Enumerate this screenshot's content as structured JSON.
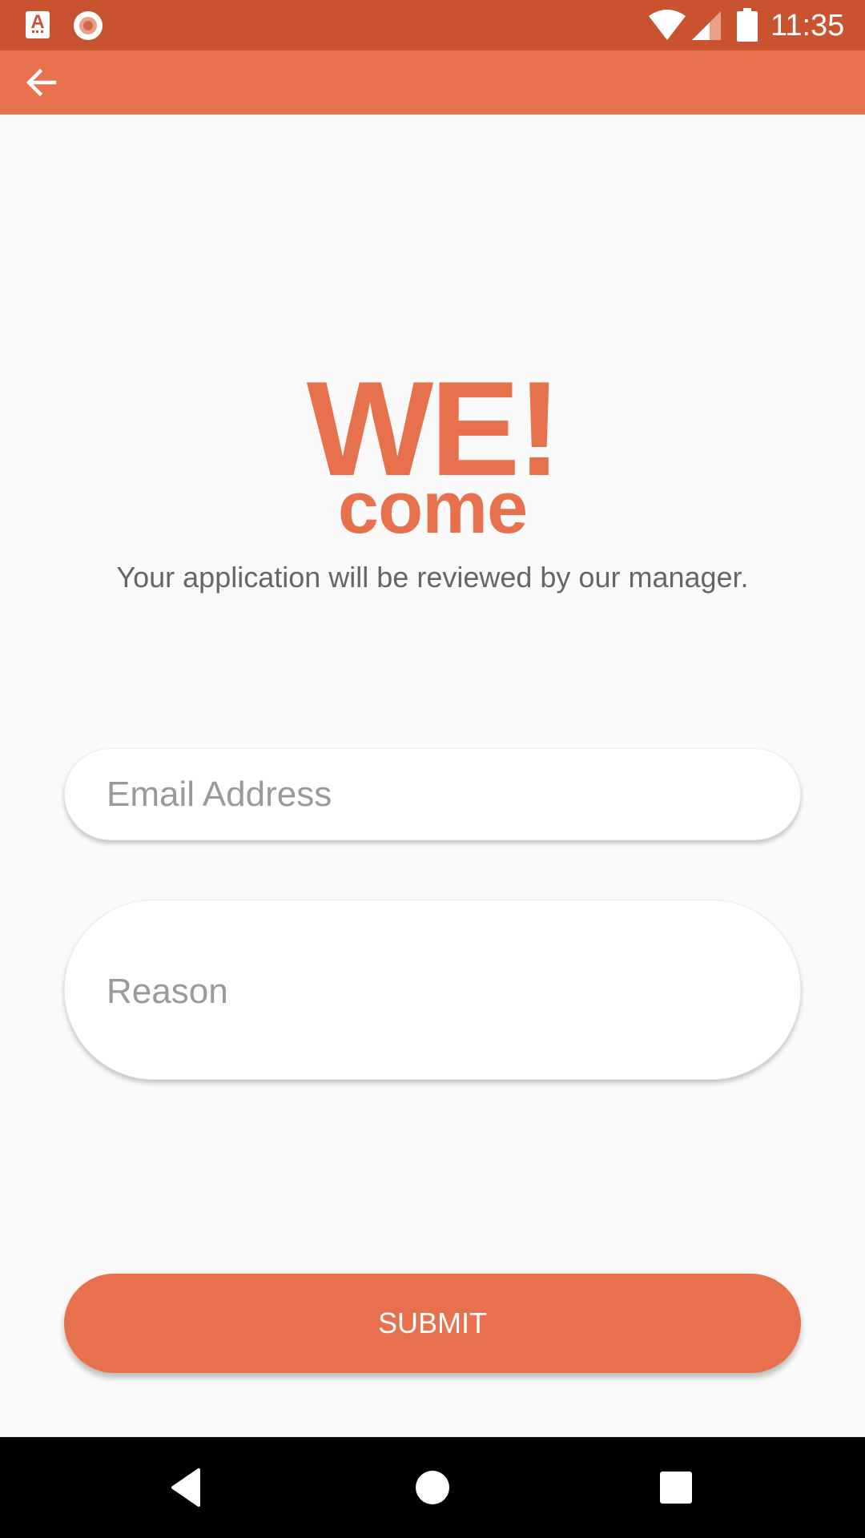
{
  "status_bar": {
    "time": "11:35",
    "icons": [
      "app-a-notification-icon",
      "record-notification-icon",
      "wifi-icon",
      "cell-signal-icon",
      "battery-icon"
    ],
    "background_color": "#c9532f"
  },
  "app_bar": {
    "back_icon": "arrow-left-icon",
    "background_color": "#e8714d"
  },
  "main": {
    "headline": "WE!",
    "subheadline": "come",
    "tagline": "Your application will be reviewed by our manager.",
    "accent_color": "#e8714d"
  },
  "form": {
    "email": {
      "placeholder": "Email Address",
      "value": ""
    },
    "reason": {
      "placeholder": "Reason",
      "value": ""
    },
    "submit_label": "SUBMIT"
  },
  "nav_bar": {
    "buttons": [
      "back-triangle-icon",
      "home-circle-icon",
      "recents-square-icon"
    ]
  }
}
